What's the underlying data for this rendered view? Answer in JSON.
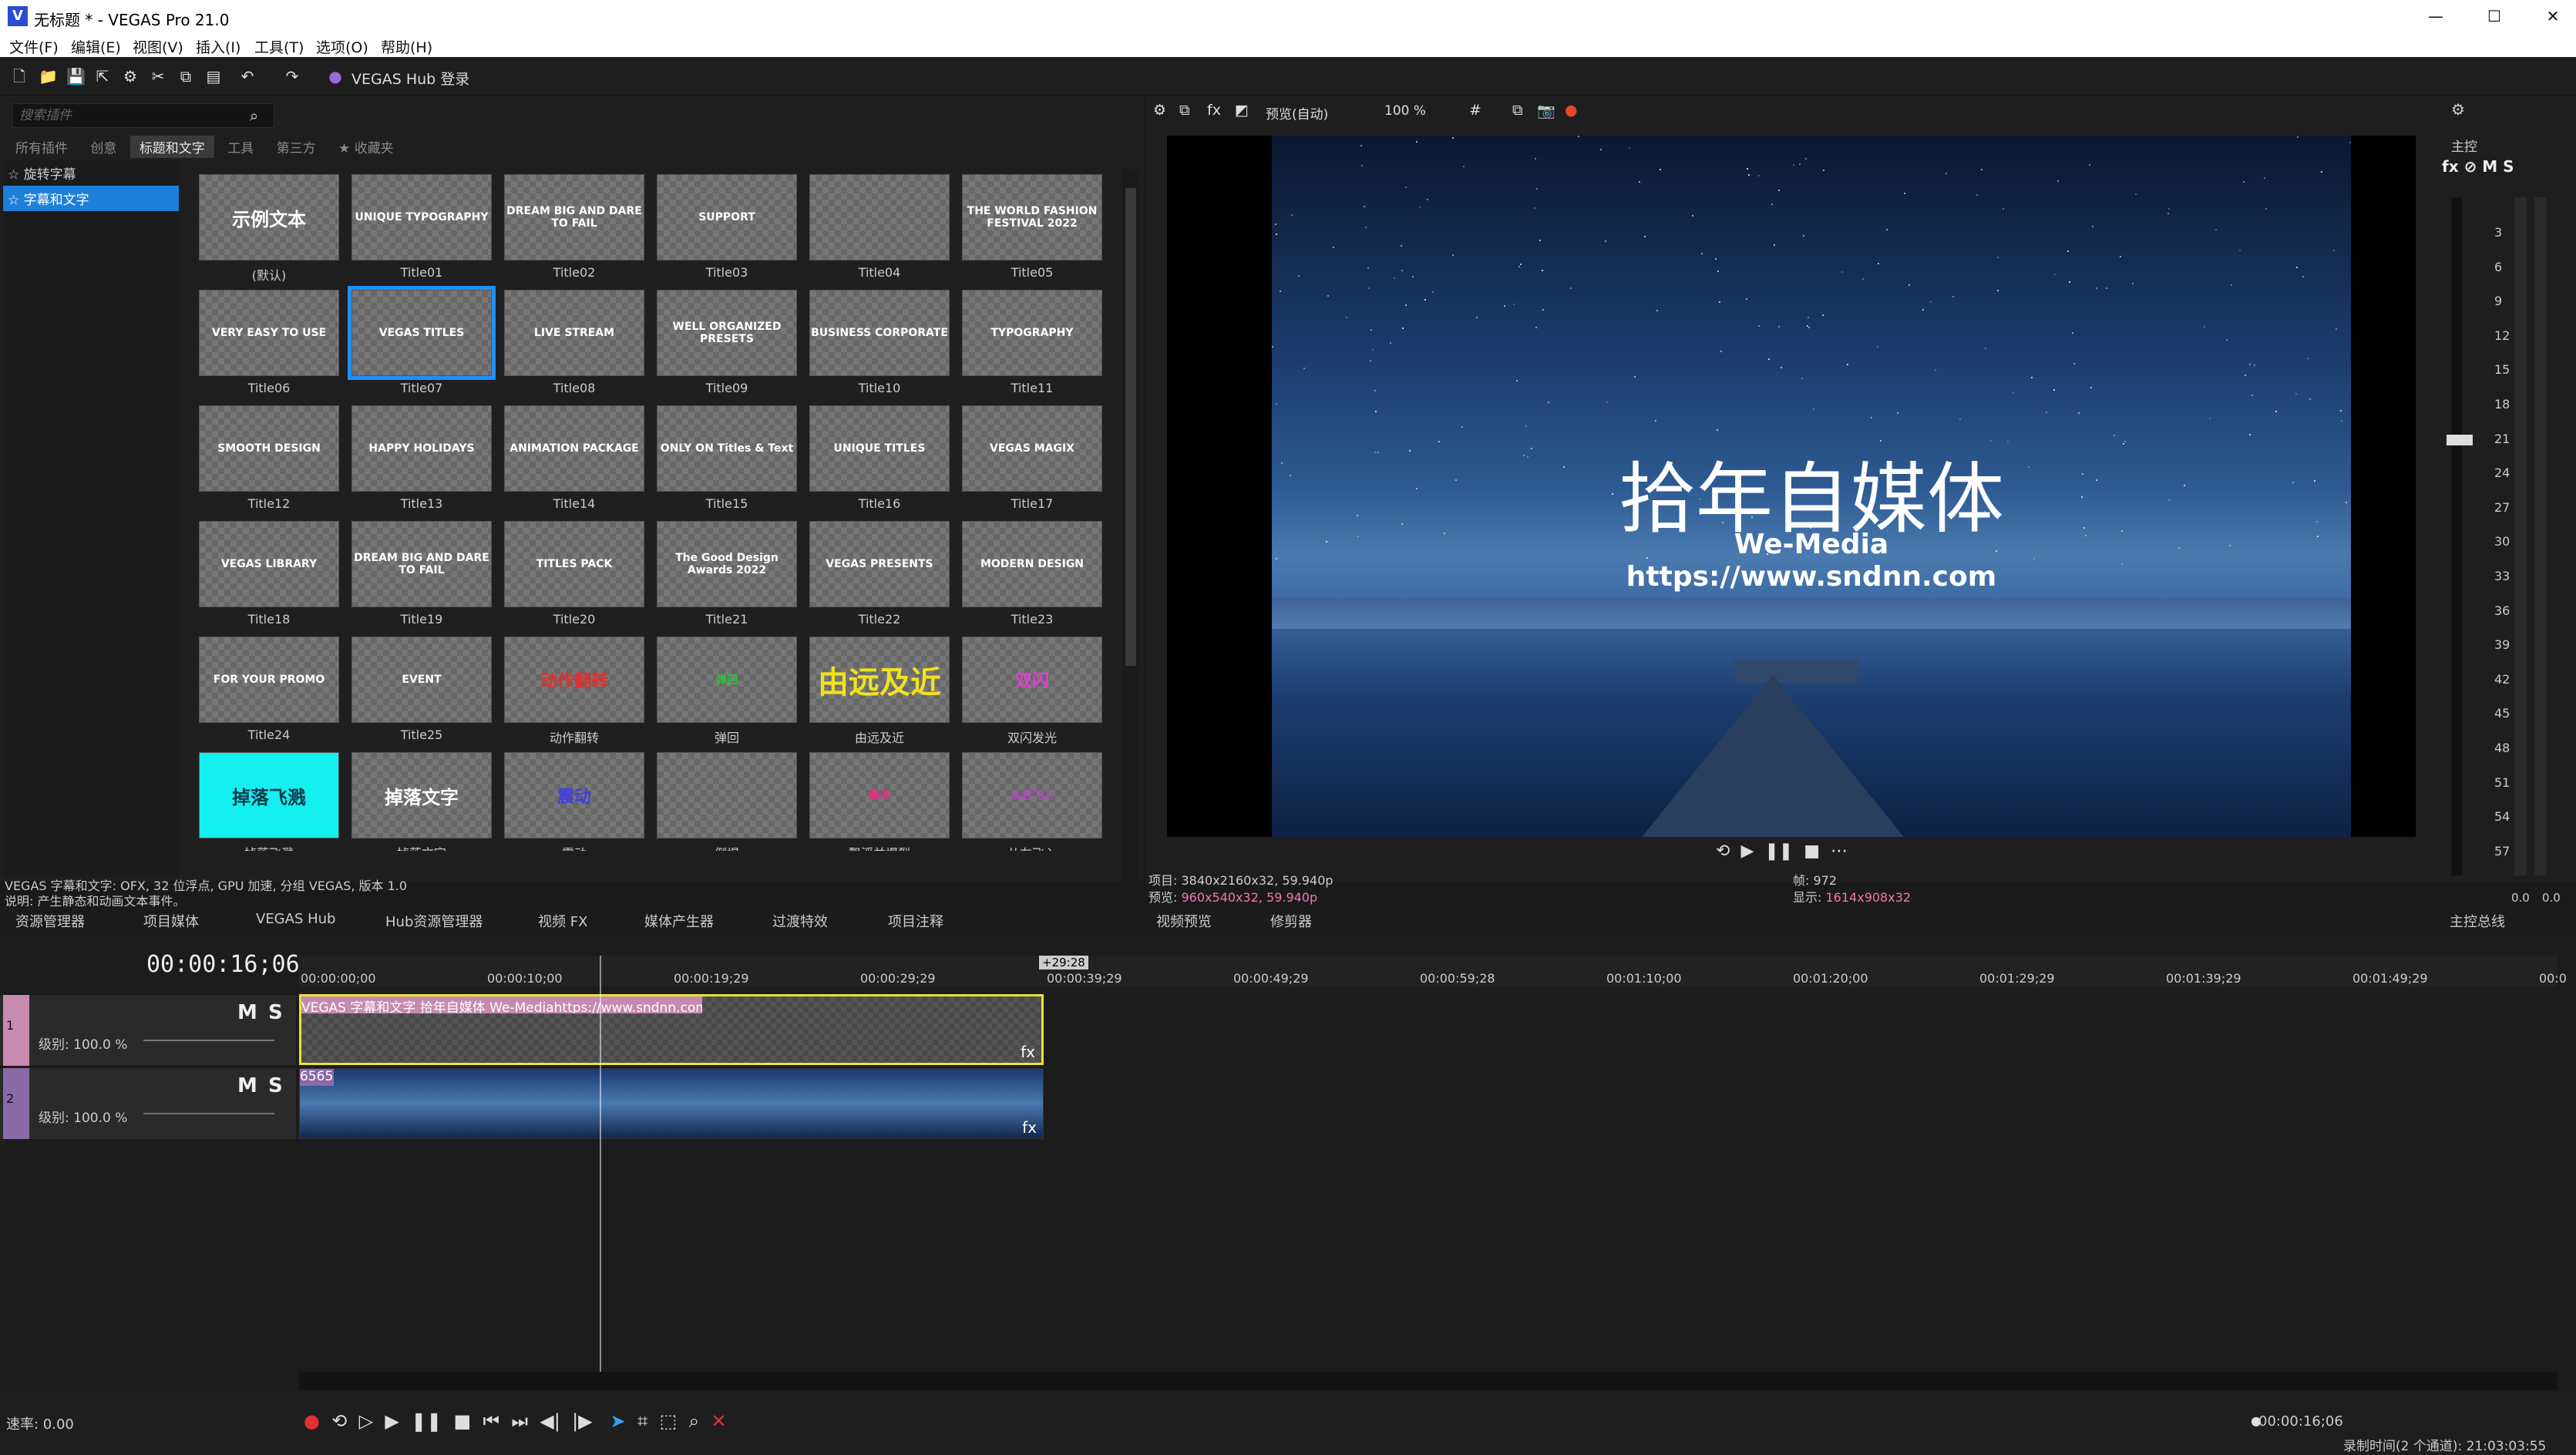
{
  "window": {
    "title": "无标题 * - VEGAS Pro 21.0",
    "app_icon": "V"
  },
  "menu": [
    "文件(F)",
    "编辑(E)",
    "视图(V)",
    "插入(I)",
    "工具(T)",
    "选项(O)",
    "帮助(H)"
  ],
  "toolbar": {
    "hub_login": "VEGAS Hub 登录"
  },
  "plugins": {
    "search_placeholder": "搜索插件",
    "tabs": [
      "所有插件",
      "创意",
      "标题和文字",
      "工具",
      "第三方",
      "收藏夹"
    ],
    "active_tab": "标题和文字",
    "tree": [
      "旋转字幕",
      "字幕和文字"
    ],
    "tiles": [
      {
        "label": "(默认)",
        "text": "示例文本"
      },
      {
        "label": "Title01",
        "text": "UNIQUE TYPOGRAPHY"
      },
      {
        "label": "Title02",
        "text": "DREAM BIG AND DARE TO FAIL"
      },
      {
        "label": "Title03",
        "text": "SUPPORT"
      },
      {
        "label": "Title04",
        "text": ""
      },
      {
        "label": "Title05",
        "text": "THE WORLD FASHION FESTIVAL 2022"
      },
      {
        "label": "Title06",
        "text": "VERY EASY TO USE"
      },
      {
        "label": "Title07",
        "text": "VEGAS TITLES"
      },
      {
        "label": "Title08",
        "text": "LIVE STREAM"
      },
      {
        "label": "Title09",
        "text": "WELL ORGANIZED PRESETS"
      },
      {
        "label": "Title10",
        "text": "BUSINESS CORPORATE"
      },
      {
        "label": "Title11",
        "text": "TYPOGRAPHY"
      },
      {
        "label": "Title12",
        "text": "SMOOTH DESIGN"
      },
      {
        "label": "Title13",
        "text": "HAPPY HOLIDAYS"
      },
      {
        "label": "Title14",
        "text": "ANIMATION PACKAGE"
      },
      {
        "label": "Title15",
        "text": "ONLY ON Titles & Text"
      },
      {
        "label": "Title16",
        "text": "UNIQUE TITLES"
      },
      {
        "label": "Title17",
        "text": "VEGAS MAGIX"
      },
      {
        "label": "Title18",
        "text": "VEGAS LIBRARY"
      },
      {
        "label": "Title19",
        "text": "DREAM BIG AND DARE TO FAIL"
      },
      {
        "label": "Title20",
        "text": "TITLES PACK"
      },
      {
        "label": "Title21",
        "text": "The Good Design Awards 2022"
      },
      {
        "label": "Title22",
        "text": "VEGAS PRESENTS"
      },
      {
        "label": "Title23",
        "text": "MODERN DESIGN"
      },
      {
        "label": "Title24",
        "text": "FOR YOUR PROMO"
      },
      {
        "label": "Title25",
        "text": "EVENT"
      },
      {
        "label": "动作翻转",
        "text": "动作翻转"
      },
      {
        "label": "弹回",
        "text": "弹回"
      },
      {
        "label": "由远及近",
        "text": "由远及近"
      },
      {
        "label": "双闪发光",
        "text": "双闪"
      },
      {
        "label": "掉落飞溅",
        "text": "掉落飞溅"
      },
      {
        "label": "掉落文字",
        "text": "掉落文字"
      },
      {
        "label": "震动",
        "text": "震动"
      },
      {
        "label": "倒塌",
        "text": ""
      },
      {
        "label": "飘浮并爆裂",
        "text": "飘浮"
      },
      {
        "label": "从右飞入",
        "text": "从右飞入"
      }
    ],
    "description_line1": "VEGAS 字幕和文字: OFX, 32 位浮点, GPU 加速, 分组 VEGAS, 版本 1.0",
    "description_line2": "说明: 产生静态和动画文本事件。"
  },
  "preview": {
    "toolbar_mode": "预览(自动)",
    "zoom": "100 %",
    "overlay_title": "拾年自媒体",
    "overlay_sub1": "We-Media",
    "overlay_sub2": "https://www.sndnn.com",
    "info_project": "项目: 3840x2160x32, 59.940p",
    "info_preview_label": "预览:",
    "info_preview_val": "960x540x32, 59.940p",
    "info_frame": "帧:       972",
    "info_display_label": "显示:",
    "info_display_val": "1614x908x32"
  },
  "master": {
    "label": "主控",
    "scale": [
      "3",
      "6",
      "9",
      "12",
      "15",
      "18",
      "21",
      "24",
      "27",
      "30",
      "33",
      "36",
      "39",
      "42",
      "45",
      "48",
      "51",
      "54",
      "57"
    ],
    "left_val": "0.0",
    "right_val": "0.0"
  },
  "lower_tabs": [
    "资源管理器",
    "项目媒体",
    "VEGAS Hub",
    "Hub资源管理器",
    "视频 FX",
    "媒体产生器",
    "过渡特效",
    "项目注释",
    "视频预览",
    "修剪器",
    "主控总线"
  ],
  "timeline": {
    "timecode": "00:00:16;06",
    "loop_end": "+29:28",
    "ruler": [
      "00:00:00;00",
      "00:00:10;00",
      "00:00:19;29",
      "00:00:29;29",
      "00:00:39;29",
      "00:00:49;29",
      "00:00:59;28",
      "00:01:10;00",
      "00:01:20;00",
      "00:01:29;29",
      "00:01:39;29",
      "00:01:49;29",
      "00:0"
    ],
    "track1": {
      "number": "1",
      "level": "级别: 100.0 %",
      "clip": "VEGAS 字幕和文字 拾年自媒体 We-Mediahttps://www.sndnn.com"
    },
    "track2": {
      "number": "2",
      "level": "级别: 100.0 %",
      "clip": "6565"
    },
    "rate": "速率: 0.00",
    "end_time": "00:00:16;06",
    "status": "录制时间(2 个通道): 21:03:03:55"
  }
}
